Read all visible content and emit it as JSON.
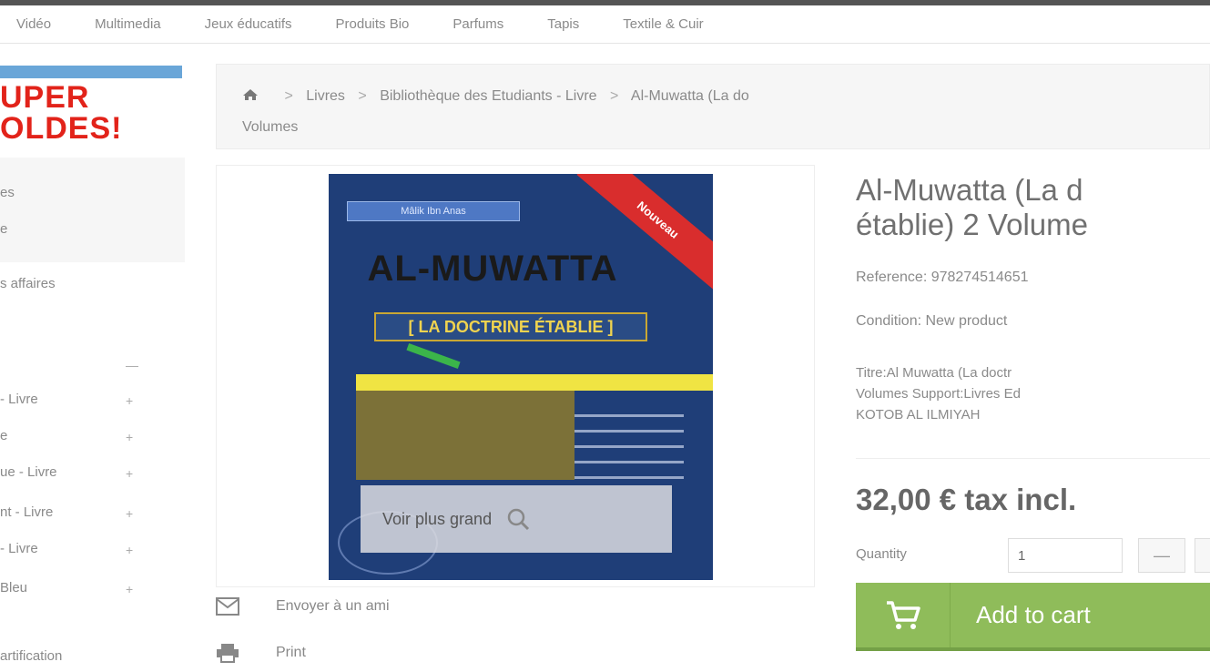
{
  "top_menu": {
    "items": [
      "Vidéo",
      "Multimedia",
      "Jeux éducatifs",
      "Produits Bio",
      "Parfums",
      "Tapis",
      "Textile & Cuir"
    ]
  },
  "banner": {
    "line1": "UPER",
    "line2": "OLDES!"
  },
  "breadcrumb": {
    "items": [
      "Livres",
      "Bibliothèque des Etudiants - Livre",
      "Al-Muwatta (La do"
    ],
    "continuation": "Volumes"
  },
  "sidebar": {
    "box_lines": [
      "es",
      "e"
    ],
    "items": [
      {
        "label": "s affaires",
        "arrow": ""
      },
      {
        "label": "",
        "arrow": "—"
      },
      {
        "label": "- Livre",
        "arrow": "+"
      },
      {
        "label": "e",
        "arrow": "+"
      },
      {
        "label": "ue - Livre",
        "arrow": "+"
      },
      {
        "label": "nt - Livre",
        "arrow": "+"
      },
      {
        "label": "- Livre",
        "arrow": "+"
      },
      {
        "label": "Bleu",
        "arrow": "+"
      },
      {
        "label": "artification",
        "arrow": ""
      }
    ]
  },
  "cover": {
    "chip": "Mâlik Ibn Anas",
    "corner": "Nouveau",
    "title": "AL-MUWATTA",
    "subtitle": "[ LA DOCTRINE ÉTABLIE ]"
  },
  "image_panel": {
    "zoom_label": "Voir plus grand"
  },
  "actions": {
    "send": "Envoyer à un ami",
    "print": "Print"
  },
  "product": {
    "title_line1": "Al-Muwatta (La d",
    "title_line2": "établie) 2 Volume",
    "reference": "Reference: 978274514651",
    "condition": "Condition: New product",
    "description_lines": [
      "Titre:Al Muwatta (La doctr",
      "Volumes Support:Livres Ed",
      "KOTOB AL ILMIYAH"
    ],
    "price": "32,00 € tax incl.",
    "quantity_label": "Quantity",
    "quantity_value": "1",
    "minus_label": "—",
    "cart_label": "Add to cart"
  },
  "colors": {
    "cart_green": "#8fbc5a",
    "banner_red": "#e2231a",
    "cover_blue": "#1f3e78"
  }
}
